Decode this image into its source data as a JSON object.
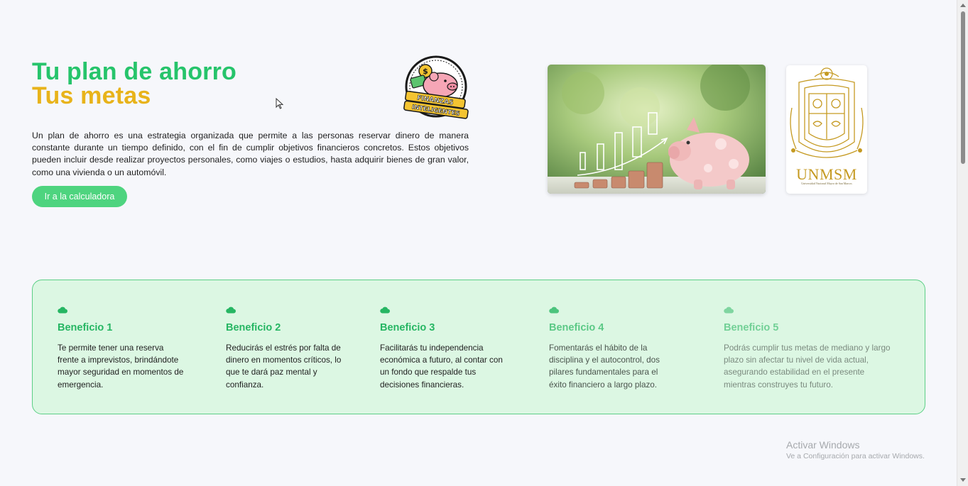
{
  "hero": {
    "title_line1": "Tu plan de ahorro",
    "title_line2": "Tus metas",
    "intro": "Un plan de ahorro es una estrategia organizada que permite a las personas reservar dinero de manera constante durante un tiempo definido, con el fin de cumplir objetivos financieros concretos. Estos objetivos pueden incluir desde realizar proyectos personales, como viajes o estudios, hasta adquirir bienes de gran valor, como una vivienda o un automóvil.",
    "cta_label": "Ir a la calculadora"
  },
  "logo": {
    "line1": "FINANZAS",
    "line2": "INTELIGENTES"
  },
  "crest": {
    "name": "UNMSM",
    "subtitle": "Universidad Nacional Mayor de San Marcos"
  },
  "benefits": [
    {
      "title": "Beneficio 1",
      "text": "Te permite tener una reserva frente a imprevistos, brindándote mayor seguridad en momentos de emergencia."
    },
    {
      "title": "Beneficio 2",
      "text": "Reducirás el estrés por falta de dinero en momentos críticos, lo que te dará paz mental y confianza."
    },
    {
      "title": "Beneficio 3",
      "text": "Facilitarás tu independencia económica a futuro, al contar con un fondo que respalde tus decisiones financieras."
    },
    {
      "title": "Beneficio 4",
      "text": "Fomentarás el hábito de la disciplina y el autocontrol, dos pilares fundamentales para el éxito financiero a largo plazo."
    },
    {
      "title": "Beneficio 5",
      "text": "Podrás cumplir tus metas de mediano y largo plazo sin afectar tu nivel de vida actual, asegurando estabilidad en el presente mientras construyes tu futuro."
    }
  ],
  "windows_watermark": {
    "title": "Activar Windows",
    "subtitle": "Ve a Configuración para activar Windows."
  },
  "colors": {
    "accent_green": "#26c46b",
    "accent_gold": "#e8b31a",
    "cta_green": "#4ed47f",
    "panel_bg": "#dcf7e3"
  },
  "icons": [
    "cloud-icon",
    "piggy-bank-logo",
    "cursor-icon"
  ]
}
